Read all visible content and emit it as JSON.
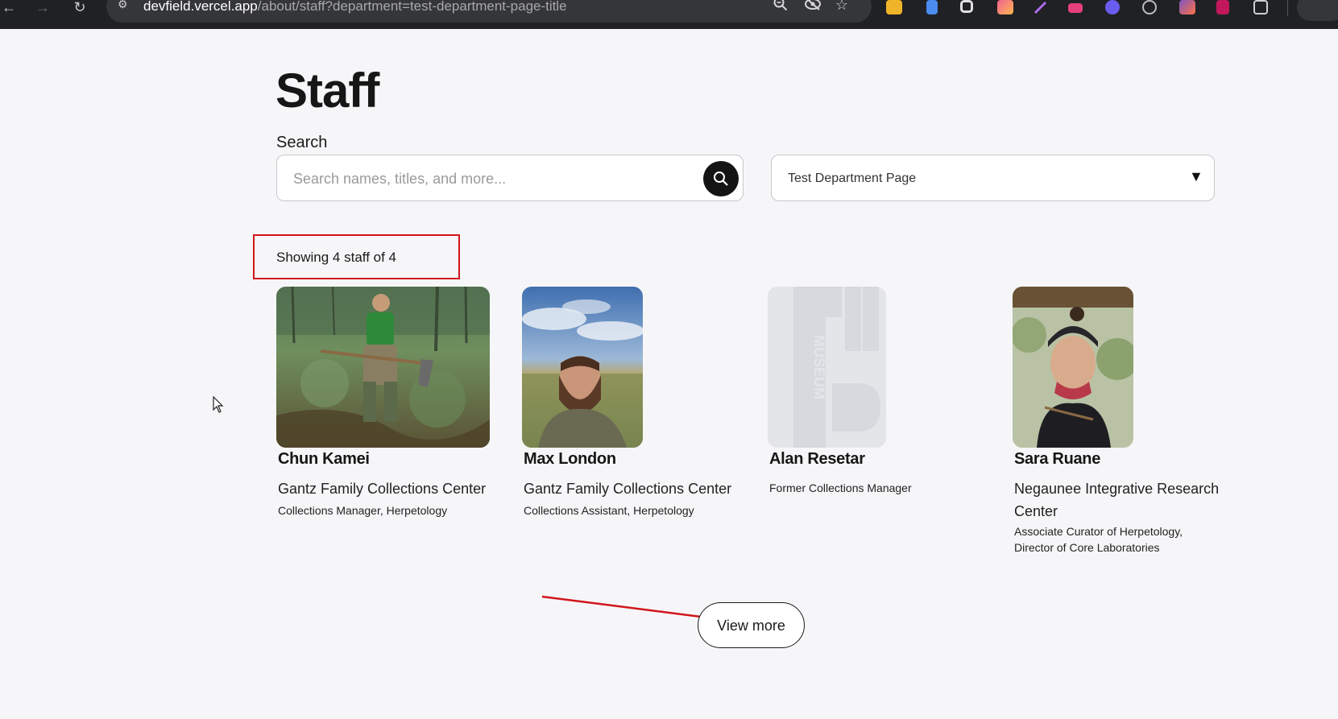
{
  "browser": {
    "url_host": "devfield.vercel.app",
    "url_path": "/about/staff?department=test-department-page-title",
    "back_icon": "arrow-left-icon",
    "forward_icon": "arrow-right-icon",
    "reload_icon": "reload-icon",
    "actions": [
      "zoom-icon",
      "eye-off-icon",
      "star-icon"
    ]
  },
  "page": {
    "title": "Staff",
    "search": {
      "label": "Search",
      "placeholder": "Search names, titles, and more...",
      "button_icon": "search-icon"
    },
    "department_select": {
      "value": "Test Department Page"
    },
    "results_count": "Showing 4 staff of 4",
    "staff": [
      {
        "name": "Chun Kamei",
        "org": "Gantz Family Collections Center",
        "role": "Collections Manager, Herpetology"
      },
      {
        "name": "Max London",
        "org": "Gantz Family Collections Center",
        "role": "Collections Assistant, Herpetology"
      },
      {
        "name": "Alan Resetar",
        "org": "",
        "role": "Former Collections Manager",
        "photo_placeholder_text": "MUSEUM"
      },
      {
        "name": "Sara Ruane",
        "org_line1": "Negaunee Integrative Research",
        "org_line2": "Center",
        "role_line1": "Associate Curator of Herpetology,",
        "role_line2": "Director of Core Laboratories"
      }
    ],
    "view_more_label": "View more"
  },
  "colors": {
    "annotation_red": "#d0161c",
    "page_bg": "#f6f6f8",
    "chrome_bg": "#202124"
  }
}
